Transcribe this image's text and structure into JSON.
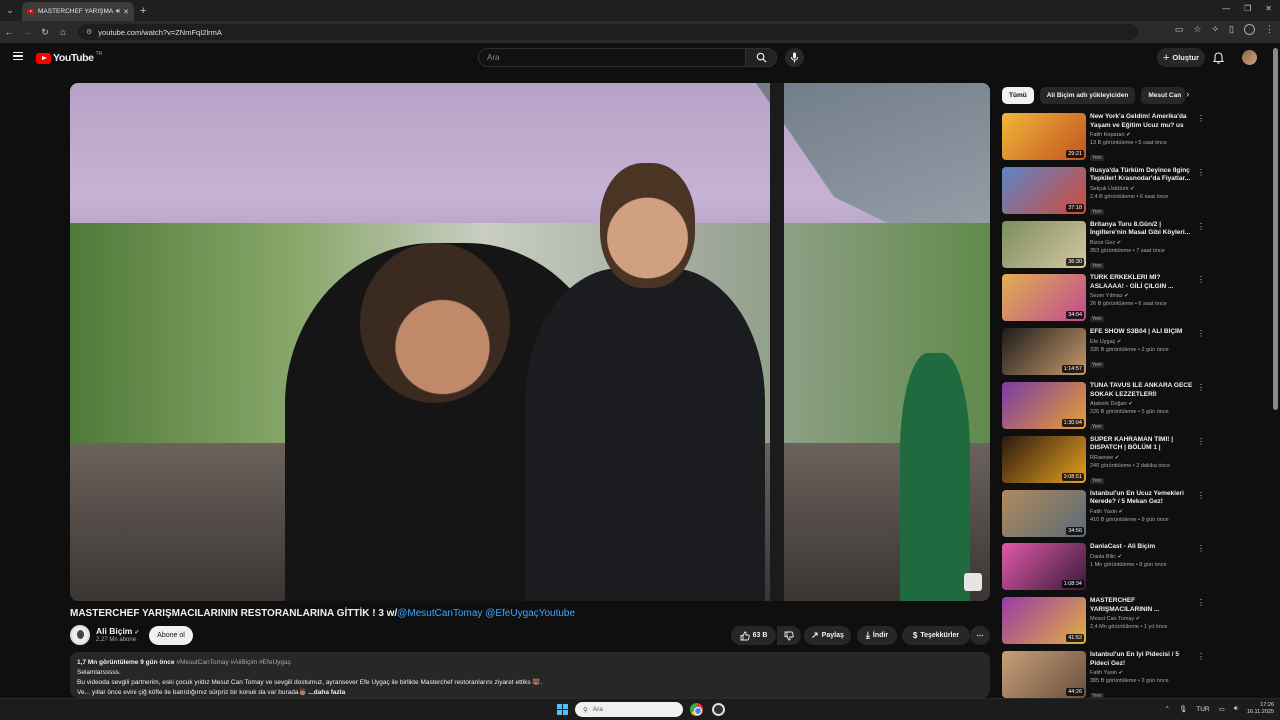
{
  "browser": {
    "tab_title": "MASTERCHEF YARIŞMACILARI...",
    "url": "youtube.com/watch?v=ZNmFqI2lrmA"
  },
  "header": {
    "logo_text": "YouTube",
    "logo_country": "TR",
    "search_placeholder": "Ara",
    "create_label": "Oluştur"
  },
  "video": {
    "title": "MASTERCHEF YARIŞMACILARININ RESTORANLARINA GİTTİK ! 3 w/",
    "title_tags": "@MesutCanTomay @EfeUygaçYoutube"
  },
  "channel": {
    "name": "Ali Biçim",
    "subscribers": "2,27 Mn abone",
    "subscribe_label": "Abone ol"
  },
  "actions": {
    "likes": "63 B",
    "share": "Paylaş",
    "download": "İndir",
    "thanks": "Teşekkürler"
  },
  "description": {
    "views": "1,7 Mn görüntüleme",
    "age": "9 gün önce",
    "hashtags": "#MesutCanTomay #AliBiçim #EfeUygaç",
    "line1": "Selamlarsssss.",
    "line2": "Bu videoda sevgili partnerim, eski çocuk yıldız Mesut Can Tomay ve sevgili dostumuz, ayransever Efe Uygaç ile birlikte Masterchef restoranlarını ziyaret ettiks 🐻.",
    "line3": "Ve... yıllar önce evini çiğ köfte ile batırdığımız sürpriz bir konuk da var burada👨🏽",
    "more": "...daha fazla"
  },
  "chips": [
    "Tümü",
    "Ali Biçim adlı yükleyiciden",
    "Mesut Can"
  ],
  "recommendations": [
    {
      "title": "New York'a Geldim! Amerika'da Yaşam ve Eğitim Ucuz mu? us",
      "channel": "Fatih Koparan",
      "meta": "13 B görüntüleme • 5 saat önce",
      "badge": "Yeni",
      "duration": "29:21",
      "colors": [
        "#f2b63a",
        "#c0531e"
      ]
    },
    {
      "title": "Rusya'da Türküm Deyince İlginç Tepkiler! Krasnodar'da Fiyatlar...",
      "channel": "Selçuk Üstütürk",
      "meta": "2,4 B görüntüleme • 6 saat önce",
      "badge": "Yeni",
      "duration": "37:18",
      "colors": [
        "#5a86c9",
        "#d24a3a"
      ]
    },
    {
      "title": "Britanya Turu 8.Gün/2 | İngiltere'nin Masal Gibi Köyleri...",
      "channel": "Bizce Gez",
      "meta": "353 görüntüleme • 7 saat önce",
      "badge": "Yeni",
      "duration": "36:30",
      "colors": [
        "#7c8e5c",
        "#d6c7a0"
      ]
    },
    {
      "title": "TÜRK ERKEKLERİ Mİ? ASLAAAA! - GİLİ ÇILGIN ...",
      "channel": "Sezer Yılmaz",
      "meta": "26 B görüntüleme • 6 saat önce",
      "badge": "Yeni",
      "duration": "34:04",
      "colors": [
        "#e0b050",
        "#c04a90"
      ]
    },
    {
      "title": "EFE SHOW S3B04 | ALİ BİÇİM",
      "channel": "Efe Uygaç",
      "meta": "335 B görüntüleme • 2 gün önce",
      "badge": "Yeni",
      "duration": "1:14:57",
      "colors": [
        "#1c1c1c",
        "#c89a6a"
      ]
    },
    {
      "title": "TUNA TAVUS İLE ANKARA GECE SOKAK LEZZETLERİ!",
      "channel": "Ataberk Doğan",
      "meta": "226 B görüntüleme • 5 gün önce",
      "badge": "Yeni",
      "duration": "1:30:04",
      "colors": [
        "#7a3aa8",
        "#e8a030"
      ]
    },
    {
      "title": "SÜPER KAHRAMAN TİMİ! | DISPATCH | BÖLÜM 1 |",
      "channel": "RRaenee",
      "meta": "240 görüntüleme • 2 dakika önce",
      "badge": "Yeni",
      "duration": "3:08:51",
      "colors": [
        "#2a1a10",
        "#e8a020"
      ]
    },
    {
      "title": "İstanbul'un En Ucuz Yemekleri Nerede? / 5 Mekan Gez!",
      "channel": "Fatih Yasin",
      "meta": "410 B görüntüleme • 9 gün önce",
      "badge": "",
      "duration": "34:56",
      "colors": [
        "#b08a5a",
        "#5a6a7a"
      ]
    },
    {
      "title": "DanlaCast - Ali Biçim",
      "channel": "Danla Bilic",
      "meta": "1 Mn görüntüleme • 8 gün önce",
      "badge": "",
      "duration": "1:08:34",
      "colors": [
        "#e05aa8",
        "#3a1a3a"
      ]
    },
    {
      "title": "MASTERCHEF YARIŞMACILARININ ...",
      "channel": "Mesut Can Tomay",
      "meta": "2,4 Mn görüntüleme • 1 yıl önce",
      "badge": "",
      "duration": "41:52",
      "colors": [
        "#9a3aa8",
        "#e0b040"
      ]
    },
    {
      "title": "İstanbul'un En İyi Pidecisi / 5 Pideci Gez!",
      "channel": "Fatih Yasin",
      "meta": "385 B görüntüleme • 2 gün önce",
      "badge": "Yeni",
      "duration": "44:26",
      "colors": [
        "#c8a078",
        "#6a5040"
      ]
    }
  ],
  "taskbar": {
    "search_placeholder": "Ara",
    "language": "TUR",
    "time": "17:26",
    "date": "16.11.2025"
  }
}
